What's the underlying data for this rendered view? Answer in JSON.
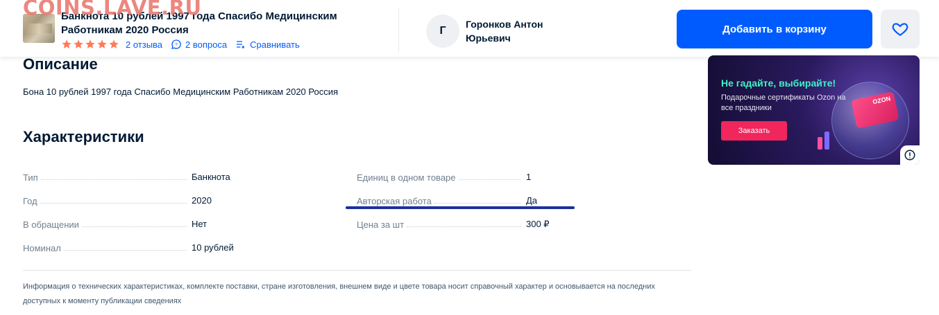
{
  "watermark": "COINS.LAVE.RU",
  "product": {
    "title": "Банкнота 10 рублей 1997 года Спасибо Медицинским Работникам 2020 Россия",
    "rating": 5,
    "reviews": "2 отзыва",
    "questions": "2 вопроса",
    "compare": "Сравнивать"
  },
  "seller": {
    "avatar_letter": "Г",
    "name": "Горонков Антон Юрьевич"
  },
  "actions": {
    "add_to_cart": "Добавить в корзину"
  },
  "description": {
    "heading": "Описание",
    "text": "Бона 10 рублей 1997 года Спасибо Медицинским Работникам 2020 Россия"
  },
  "specs": {
    "heading": "Характеристики",
    "left": [
      {
        "name": "Тип",
        "value": "Банкнота"
      },
      {
        "name": "Год",
        "value": "2020"
      },
      {
        "name": "В обращении",
        "value": "Нет"
      },
      {
        "name": "Номинал",
        "value": "10 рублей"
      }
    ],
    "right": [
      {
        "name": "Единиц в одном товаре",
        "value": "1"
      },
      {
        "name": "Авторская работа",
        "value": "Да"
      },
      {
        "name": "Цена за шт",
        "value": "300 ₽"
      }
    ]
  },
  "disclaimer": "Информация о технических характеристиках, комплекте поставки, стране изготовления, внешнем виде и цвете товара носит справочный характер и основывается на последних доступных к моменту публикации сведениях",
  "banner": {
    "headline": "Не гадайте, выбирайте!",
    "subtitle": "Подарочные сертификаты Ozon на все праздники",
    "button": "Заказать",
    "card_brand": "OZON"
  },
  "colors": {
    "accent": "#005bff",
    "star": "#ff7a59",
    "annotation_underline": "#1c2f9e"
  }
}
